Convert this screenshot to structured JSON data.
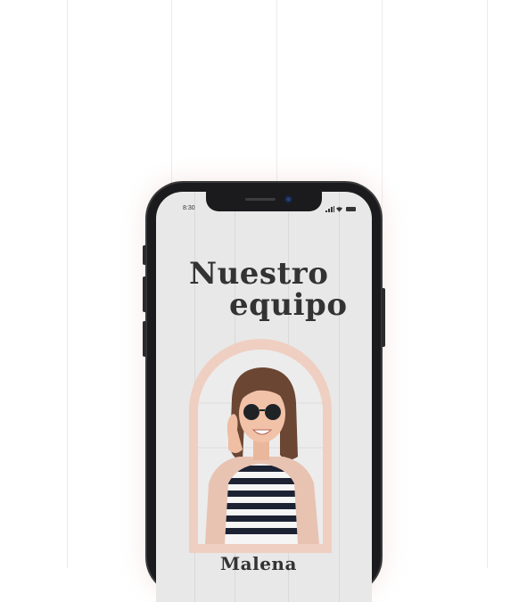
{
  "status_bar": {
    "time": "8:30",
    "icons": [
      "signal-icon",
      "wifi-icon",
      "battery-icon"
    ]
  },
  "screen": {
    "title_line1": "Nuestro",
    "title_line2": "equipo",
    "member": {
      "name": "Malena"
    }
  },
  "colors": {
    "page_background": "#ffffff",
    "screen_background": "#e8e8e8",
    "phone_frame": "#1b1b1d",
    "arch_frame": "#efcfc1",
    "title_text": "#333333"
  }
}
